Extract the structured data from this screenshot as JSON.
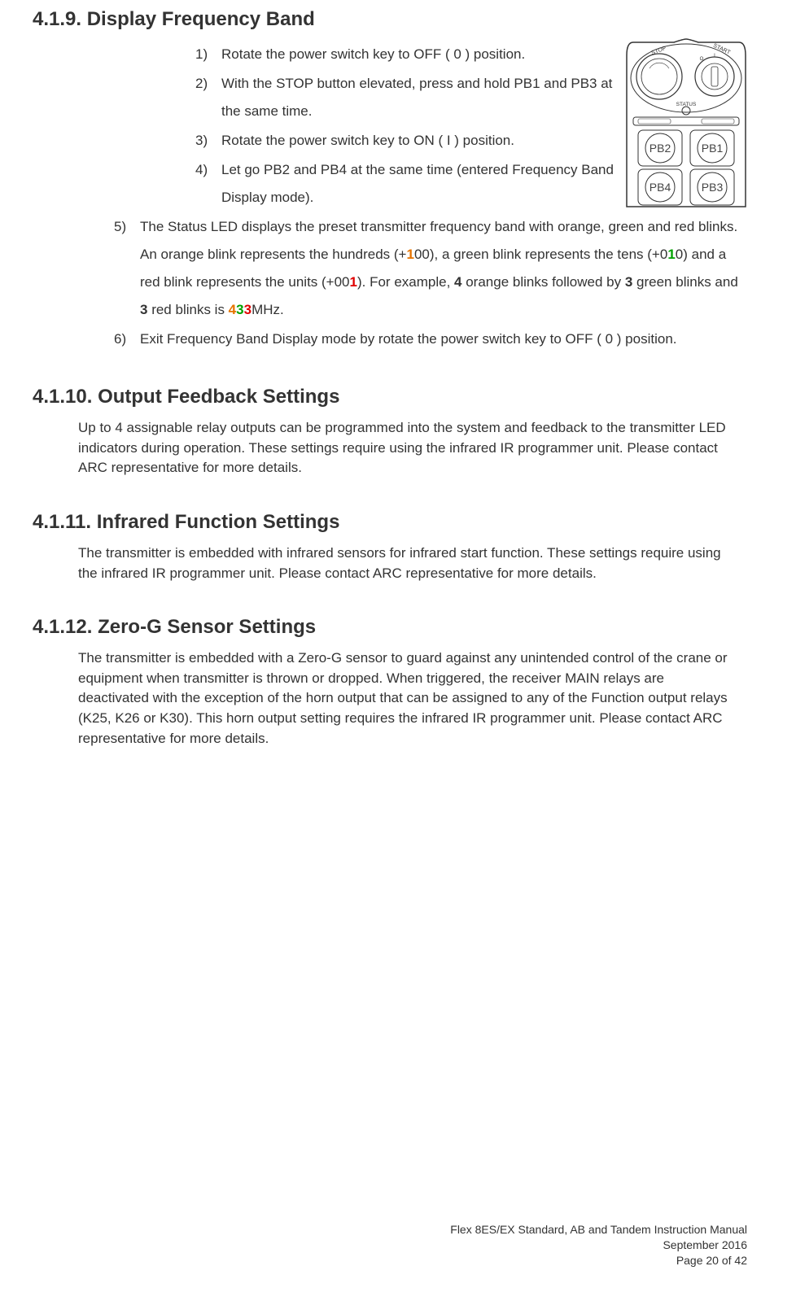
{
  "sections": {
    "s1": {
      "heading": "4.1.9. Display Frequency Band",
      "steps": [
        {
          "n": "1)",
          "t": "Rotate the power switch key to OFF ( 0 ) position."
        },
        {
          "n": "2)",
          "t": "With the STOP button elevated, press and hold PB1 and PB3 at the same time."
        },
        {
          "n": "3)",
          "t": "Rotate the power switch key to ON ( I ) position."
        },
        {
          "n": "4)",
          "t": "Let go PB2 and PB4 at the same time (entered Frequency Band Display mode)."
        },
        {
          "n": "5)"
        },
        {
          "n": "6)",
          "t": "Exit Frequency Band Display mode by rotate the power switch key to OFF ( 0 ) position."
        }
      ],
      "step5": {
        "pre": "The Status LED displays the preset transmitter frequency band with orange, green and red blinks.  An orange blink represents the hundreds (+",
        "h1": "1",
        "mid1": "00), a green blink represents the tens (+0",
        "t1": "1",
        "mid2": "0) and a red blink represents the units (+00",
        "u1": "1",
        "mid3": ").  For example, ",
        "b4": "4",
        "mid4": " orange blinks followed by ",
        "b3a": "3",
        "mid5": " green blinks and ",
        "b3b": "3",
        "mid6": " red blinks is ",
        "d1": "4",
        "d2": "3",
        "d3": "3",
        "mid7": "MHz."
      }
    },
    "s2": {
      "heading": "4.1.10.    Output Feedback Settings",
      "para": "Up to 4 assignable relay outputs can be programmed into the system and feedback to the transmitter LED indicators during operation.  These settings require using the infrared IR programmer unit.  Please contact ARC representative for more details."
    },
    "s3": {
      "heading": "4.1.11.    Infrared Function Settings",
      "para": "The transmitter is embedded with infrared sensors for infrared start function.  These settings require using the infrared IR programmer unit.  Please contact ARC representative for more details."
    },
    "s4": {
      "heading": "4.1.12.    Zero-G Sensor Settings",
      "para": "The transmitter is embedded with a Zero-G sensor to guard against any unintended control of the crane or equipment when transmitter is thrown or dropped.  When triggered, the receiver MAIN relays are deactivated with the exception of the horn output that can be assigned to any of the Function output relays (K25, K26 or K30).  This horn output setting requires the infrared IR programmer unit.  Please contact ARC representative for more details."
    }
  },
  "diagram": {
    "stop": "STOP",
    "start": "START",
    "status": "STATUS",
    "on": "I",
    "off": "O",
    "pb1": "PB1",
    "pb2": "PB2",
    "pb3": "PB3",
    "pb4": "PB4"
  },
  "footer": {
    "l1": "Flex 8ES/EX Standard, AB and Tandem Instruction Manual",
    "l2": "September 2016",
    "l3": "Page 20 of 42"
  }
}
